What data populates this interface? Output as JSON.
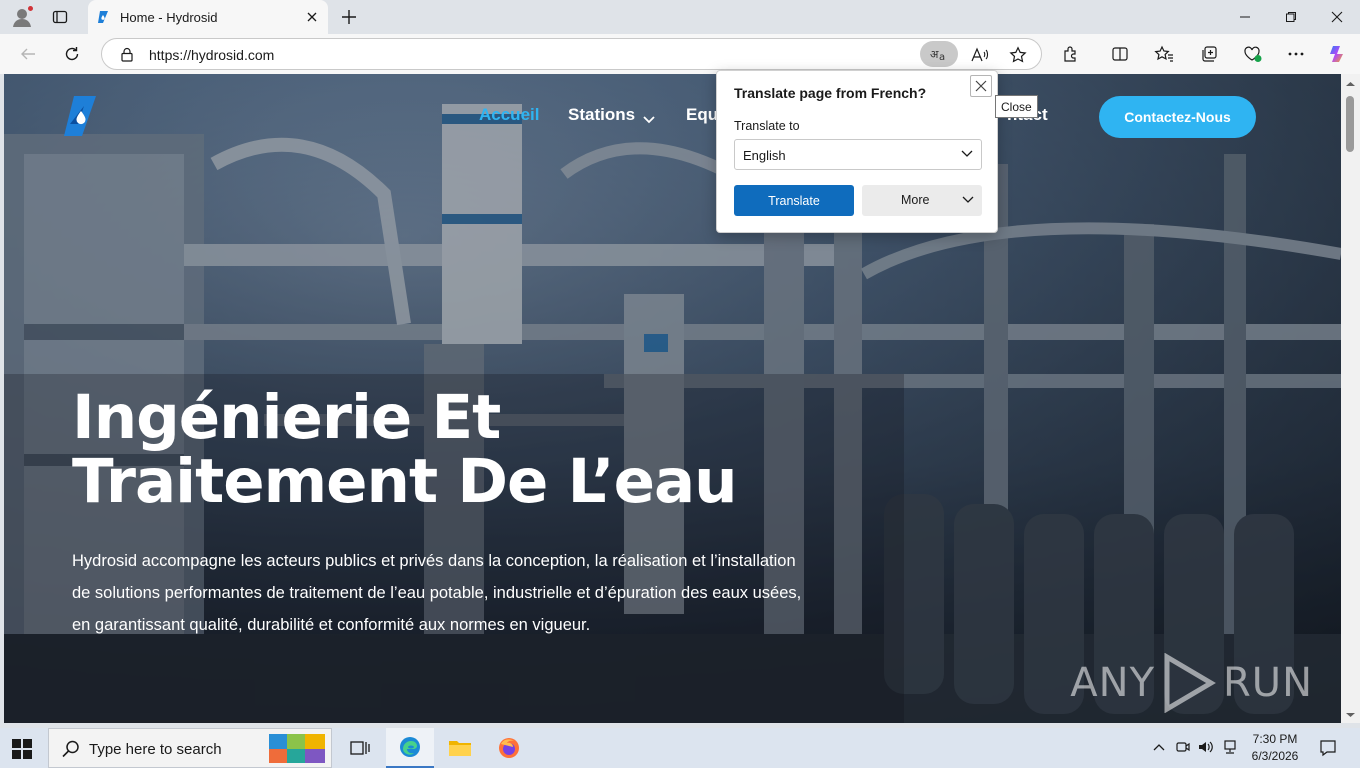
{
  "browser": {
    "tab_title": "Home - Hydrosid",
    "url": "https://hydrosid.com"
  },
  "site": {
    "nav": {
      "accueil": "Accueil",
      "stations": "Stations",
      "equipements_partial": "Equ",
      "contact_partial": "ntact",
      "cta": "Contactez-Nous"
    },
    "hero": {
      "title_line1": "Ingénierie Et",
      "title_line2": "Traitement De L’eau",
      "text": "Hydrosid accompagne les acteurs publics et privés dans la conception, la réalisation et l’installation de solutions performantes de traitement de l’eau potable, industrielle et d’épuration des eaux usées, en garantissant qualité, durabilité et conformité aux normes en vigueur."
    },
    "accent_color": "#2fb4f2"
  },
  "translate_popup": {
    "title": "Translate page from French?",
    "label": "Translate to",
    "language": "English",
    "translate_button": "Translate",
    "more_button": "More",
    "close_tooltip": "Close"
  },
  "watermark": {
    "left": "ANY",
    "right": "RUN"
  },
  "taskbar": {
    "search_placeholder": "Type here to search",
    "time": "7:30 PM",
    "date": "6/3/2026"
  }
}
